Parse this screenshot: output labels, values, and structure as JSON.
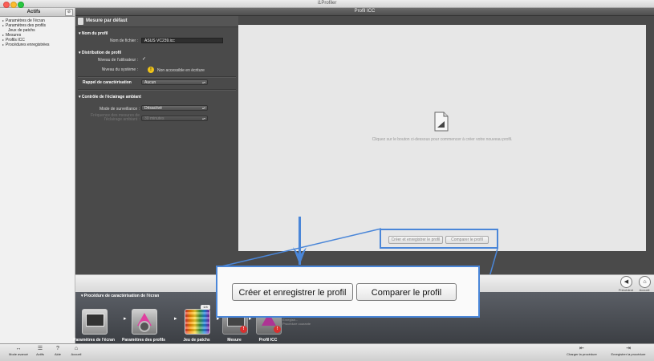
{
  "window": {
    "title": "i1Profiler"
  },
  "sidebar": {
    "header": "Actifs",
    "header_button": "⊘",
    "items": [
      {
        "label": "Paramètres de l'écran",
        "expandable": true
      },
      {
        "label": "Paramètres des profils",
        "expandable": true
      },
      {
        "label": "Jeux de patchs",
        "expandable": false
      },
      {
        "label": "Mesures",
        "expandable": true
      },
      {
        "label": "Profils ICC",
        "expandable": true
      },
      {
        "label": "Procédures enregistrées",
        "expandable": true
      }
    ]
  },
  "top": {
    "tab": "Profil ICC"
  },
  "panel": {
    "title": "Mesure par défaut",
    "name_section": "Nom du profil",
    "filename_label": "Nom de fichier :",
    "filename_value": "ASUS VC239.icc",
    "dist_section": "Distribution de profil",
    "user_level_label": "Niveau de l'utilisateur :",
    "user_level_check": "✓",
    "system_level_label": "Niveau du système :",
    "system_level_warn": "!",
    "system_level_value": "Non accessible en écriture",
    "recall_label": "Rappel de caractérisation",
    "recall_value": "Aucun",
    "ambient_section": "Contrôle de l'éclairage ambiant",
    "monitor_label": "Mode de surveillance :",
    "monitor_value": "Désactivé",
    "interval_label": "Fréquence des mesures de l'éclairage ambiant :",
    "interval_value": "30 minutes"
  },
  "canvas": {
    "hint": "Cliquez sur le bouton ci-dessous pour commencer à créer votre nouveau profil.",
    "create_button": "Créer et enregistrer le profil",
    "compare_button": "Comparer le profil"
  },
  "nav": {
    "previous_label": "Précédent",
    "home_label": "Accueil",
    "previous_icon": "◀",
    "home_icon": "⌂"
  },
  "workflow": {
    "title": "Procédure de caractérisation de l'écran",
    "steps": [
      {
        "label": "Paramètres de l'écran"
      },
      {
        "label": "Paramètres des profils"
      },
      {
        "label": "Jeu de patchs"
      },
      {
        "label": "Mesure",
        "badge": "!"
      },
      {
        "label": "Profil ICC",
        "badge": "!"
      }
    ],
    "tile_tag": "1/4",
    "arrow": "▸",
    "save_hint_1": "Enregistr...",
    "save_hint_2": "Procédure courante"
  },
  "bottom_toolbar": {
    "left": [
      {
        "label": "Mode avancé",
        "icon": "↔"
      },
      {
        "label": "Actifs",
        "icon": "☰"
      },
      {
        "label": "Aide",
        "icon": "?"
      },
      {
        "label": "Accueil",
        "icon": "⌂"
      }
    ],
    "right": [
      {
        "label": "Charger la procédure",
        "icon": "⇤"
      },
      {
        "label": "Enregistrer la procédure",
        "icon": "⇥"
      }
    ]
  },
  "callout": {
    "create_button": "Créer et enregistrer le profil",
    "compare_button": "Comparer le profil"
  },
  "colors": {
    "accent": "#4a86d8",
    "panel": "#4a4a4a",
    "canvas": "#e7e7e7",
    "badge": "#d9302f"
  }
}
